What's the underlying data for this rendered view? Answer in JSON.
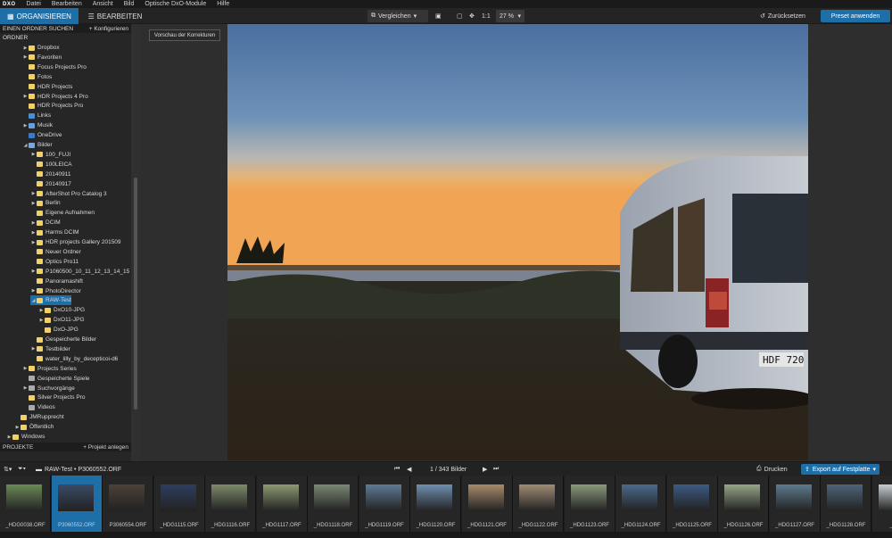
{
  "app": {
    "logo": "DXO"
  },
  "menu": [
    "Datei",
    "Bearbeiten",
    "Ansicht",
    "Bild",
    "Optische DxO-Module",
    "Hilfe"
  ],
  "tabs": {
    "organize": "ORGANISIEREN",
    "edit": "BEARBEITEN"
  },
  "toolbar": {
    "compare": "Vergleichen",
    "one_to_one": "1:1",
    "zoom": "27 %",
    "reset": "Zurücksetzen",
    "apply_preset": "Preset anwenden"
  },
  "left_panel": {
    "search_header": "EINEN ORDNER SUCHEN",
    "configure": "+ Konfigurieren",
    "folder_header": "ORDNER",
    "projects_header": "PROJEKTE",
    "add_project": "+ Projekt anlegen",
    "tree": [
      {
        "label": "Dropbox",
        "level": 3,
        "arrow": "▶",
        "icon": "folder"
      },
      {
        "label": "Favoriten",
        "level": 3,
        "arrow": "▶",
        "icon": "star"
      },
      {
        "label": "Focus Projects Pro",
        "level": 3,
        "arrow": "",
        "icon": "folder"
      },
      {
        "label": "Fotos",
        "level": 3,
        "arrow": "",
        "icon": "folder"
      },
      {
        "label": "HDR Projects",
        "level": 3,
        "arrow": "",
        "icon": "folder"
      },
      {
        "label": "HDR Projects 4 Pro",
        "level": 3,
        "arrow": "▶",
        "icon": "folder"
      },
      {
        "label": "HDR Projects Pro",
        "level": 3,
        "arrow": "",
        "icon": "folder"
      },
      {
        "label": "Links",
        "level": 3,
        "arrow": "",
        "icon": "link"
      },
      {
        "label": "Musik",
        "level": 3,
        "arrow": "▶",
        "icon": "music"
      },
      {
        "label": "OneDrive",
        "level": 3,
        "arrow": "",
        "icon": "cloud"
      },
      {
        "label": "Bilder",
        "level": 3,
        "arrow": "◢",
        "icon": "pictures"
      },
      {
        "label": "100_FUJI",
        "level": 4,
        "arrow": "▶",
        "icon": "folder"
      },
      {
        "label": "100LEICA",
        "level": 4,
        "arrow": "",
        "icon": "folder"
      },
      {
        "label": "20140911",
        "level": 4,
        "arrow": "",
        "icon": "folder"
      },
      {
        "label": "20140917",
        "level": 4,
        "arrow": "",
        "icon": "folder"
      },
      {
        "label": "AfterShot Pro Catalog 3",
        "level": 4,
        "arrow": "▶",
        "icon": "folder"
      },
      {
        "label": "Berlin",
        "level": 4,
        "arrow": "▶",
        "icon": "folder"
      },
      {
        "label": "Eigene Aufnahmen",
        "level": 4,
        "arrow": "",
        "icon": "folder"
      },
      {
        "label": "DCIM",
        "level": 4,
        "arrow": "▶",
        "icon": "folder"
      },
      {
        "label": "Harms DCIM",
        "level": 4,
        "arrow": "▶",
        "icon": "folder"
      },
      {
        "label": "HDR projects Gallery 201509",
        "level": 4,
        "arrow": "▶",
        "icon": "folder"
      },
      {
        "label": "Neuer Ordner",
        "level": 4,
        "arrow": "",
        "icon": "folder"
      },
      {
        "label": "Optics Pro11",
        "level": 4,
        "arrow": "",
        "icon": "folder"
      },
      {
        "label": "P1060500_10_11_12_13_14_15",
        "level": 4,
        "arrow": "▶",
        "icon": "folder"
      },
      {
        "label": "Panoramashift",
        "level": 4,
        "arrow": "",
        "icon": "folder"
      },
      {
        "label": "PhotoDirector",
        "level": 4,
        "arrow": "▶",
        "icon": "folder"
      },
      {
        "label": "RAW-Test",
        "level": 4,
        "arrow": "◢",
        "icon": "folder",
        "selected": true
      },
      {
        "label": "DxO10-JPG",
        "level": 5,
        "arrow": "▶",
        "icon": "folder"
      },
      {
        "label": "DxO11-JPG",
        "level": 5,
        "arrow": "▶",
        "icon": "folder"
      },
      {
        "label": "DxO-JPG",
        "level": 5,
        "arrow": "",
        "icon": "folder"
      },
      {
        "label": "Gespeicherte Bilder",
        "level": 4,
        "arrow": "",
        "icon": "folder"
      },
      {
        "label": "Testbilder",
        "level": 4,
        "arrow": "▶",
        "icon": "folder"
      },
      {
        "label": "water_lilly_by_decepticoi-d6",
        "level": 4,
        "arrow": "",
        "icon": "folder"
      },
      {
        "label": "Projects Series",
        "level": 3,
        "arrow": "▶",
        "icon": "folder"
      },
      {
        "label": "Gespeicherte Spiele",
        "level": 3,
        "arrow": "",
        "icon": "gamepad"
      },
      {
        "label": "Suchvorgänge",
        "level": 3,
        "arrow": "▶",
        "icon": "search"
      },
      {
        "label": "Silver Projects Pro",
        "level": 3,
        "arrow": "",
        "icon": "folder"
      },
      {
        "label": "Videos",
        "level": 3,
        "arrow": "",
        "icon": "video"
      },
      {
        "label": "JMRupprecht",
        "level": 2,
        "arrow": "",
        "icon": "folder"
      },
      {
        "label": "Öffentlich",
        "level": 2,
        "arrow": "▶",
        "icon": "folder"
      },
      {
        "label": "Windows",
        "level": 1,
        "arrow": "▶",
        "icon": "folder"
      }
    ]
  },
  "viewer": {
    "preview_button": "Vorschau der Korrekturen",
    "plate": "HDF 720"
  },
  "filmstrip_bar": {
    "path": "RAW-Test • P3060552.ORF",
    "counter": "1 / 343  Bilder",
    "print": "Drucken",
    "export": "Export auf Festplatte"
  },
  "thumbnails": [
    {
      "label": "_HDG0038.ORF",
      "hue": "#6a8a55",
      "selected": false
    },
    {
      "label": "P3060552.ORF",
      "hue": "#3a4a64",
      "selected": true
    },
    {
      "label": "P3060554.ORF",
      "hue": "#4c4238",
      "selected": false
    },
    {
      "label": "_HDG1115.ORF",
      "hue": "#2e3d5e",
      "selected": false
    },
    {
      "label": "_HDG1116.ORF",
      "hue": "#7d8a6a",
      "selected": false
    },
    {
      "label": "_HDG1117.ORF",
      "hue": "#8c9a72",
      "selected": false
    },
    {
      "label": "_HDG1118.ORF",
      "hue": "#7a8874",
      "selected": false
    },
    {
      "label": "_HDG1119.ORF",
      "hue": "#5f7a96",
      "selected": false
    },
    {
      "label": "_HDG1120.ORF",
      "hue": "#6f8fb0",
      "selected": false
    },
    {
      "label": "_HDG1121.ORF",
      "hue": "#a88a6a",
      "selected": false
    },
    {
      "label": "_HDG1122.ORF",
      "hue": "#a08c74",
      "selected": false
    },
    {
      "label": "_HDG1123.ORF",
      "hue": "#8a9a7a",
      "selected": false
    },
    {
      "label": "_HDG1124.ORF",
      "hue": "#4a6a8c",
      "selected": false
    },
    {
      "label": "_HDG1125.ORF",
      "hue": "#3d5a82",
      "selected": false
    },
    {
      "label": "_HDG1126.ORF",
      "hue": "#98a688",
      "selected": false
    },
    {
      "label": "_HDG1127.ORF",
      "hue": "#5e7a8e",
      "selected": false
    },
    {
      "label": "_HDG1128.ORF",
      "hue": "#4e6478",
      "selected": false
    },
    {
      "label": "_HDG",
      "hue": "#c8ccd0",
      "selected": false
    }
  ]
}
